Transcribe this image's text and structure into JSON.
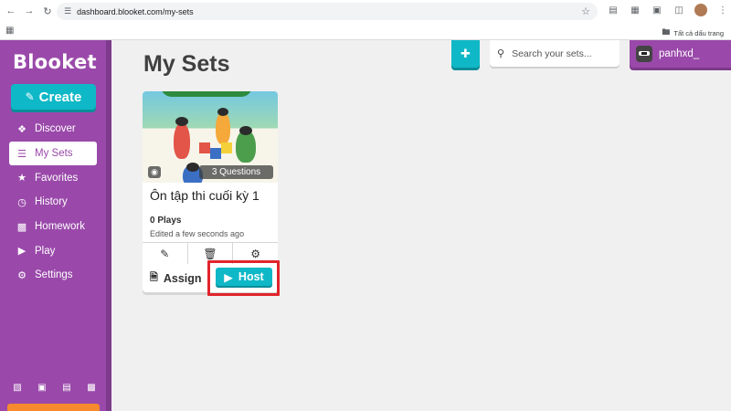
{
  "browser": {
    "url": "dashboard.blooket.com/my-sets",
    "bookmarks_folder": "Tất cả dấu trang"
  },
  "sidebar": {
    "logo": "Blooket",
    "create_label": "Create",
    "items": [
      {
        "label": "Discover",
        "icon": "compass-icon",
        "active": false
      },
      {
        "label": "My Sets",
        "icon": "list-icon",
        "active": true
      },
      {
        "label": "Favorites",
        "icon": "star-icon",
        "active": false
      },
      {
        "label": "History",
        "icon": "history-icon",
        "active": false
      },
      {
        "label": "Homework",
        "icon": "homework-icon",
        "active": false
      },
      {
        "label": "Play",
        "icon": "play-icon",
        "active": false
      },
      {
        "label": "Settings",
        "icon": "gear-icon",
        "active": false
      }
    ]
  },
  "header": {
    "page_title": "My Sets",
    "search_placeholder": "Search your sets...",
    "username": "panhxd_"
  },
  "sets": [
    {
      "title": "Ôn tập thi cuối kỳ 1",
      "questions": "3 Questions",
      "plays": "0 Plays",
      "edited": "Edited a few seconds ago",
      "assign_label": "Assign",
      "host_label": "Host"
    }
  ],
  "colors": {
    "sidebar": "#9a49aa",
    "accent": "#0fb8c7",
    "highlight": "#e0252b"
  }
}
